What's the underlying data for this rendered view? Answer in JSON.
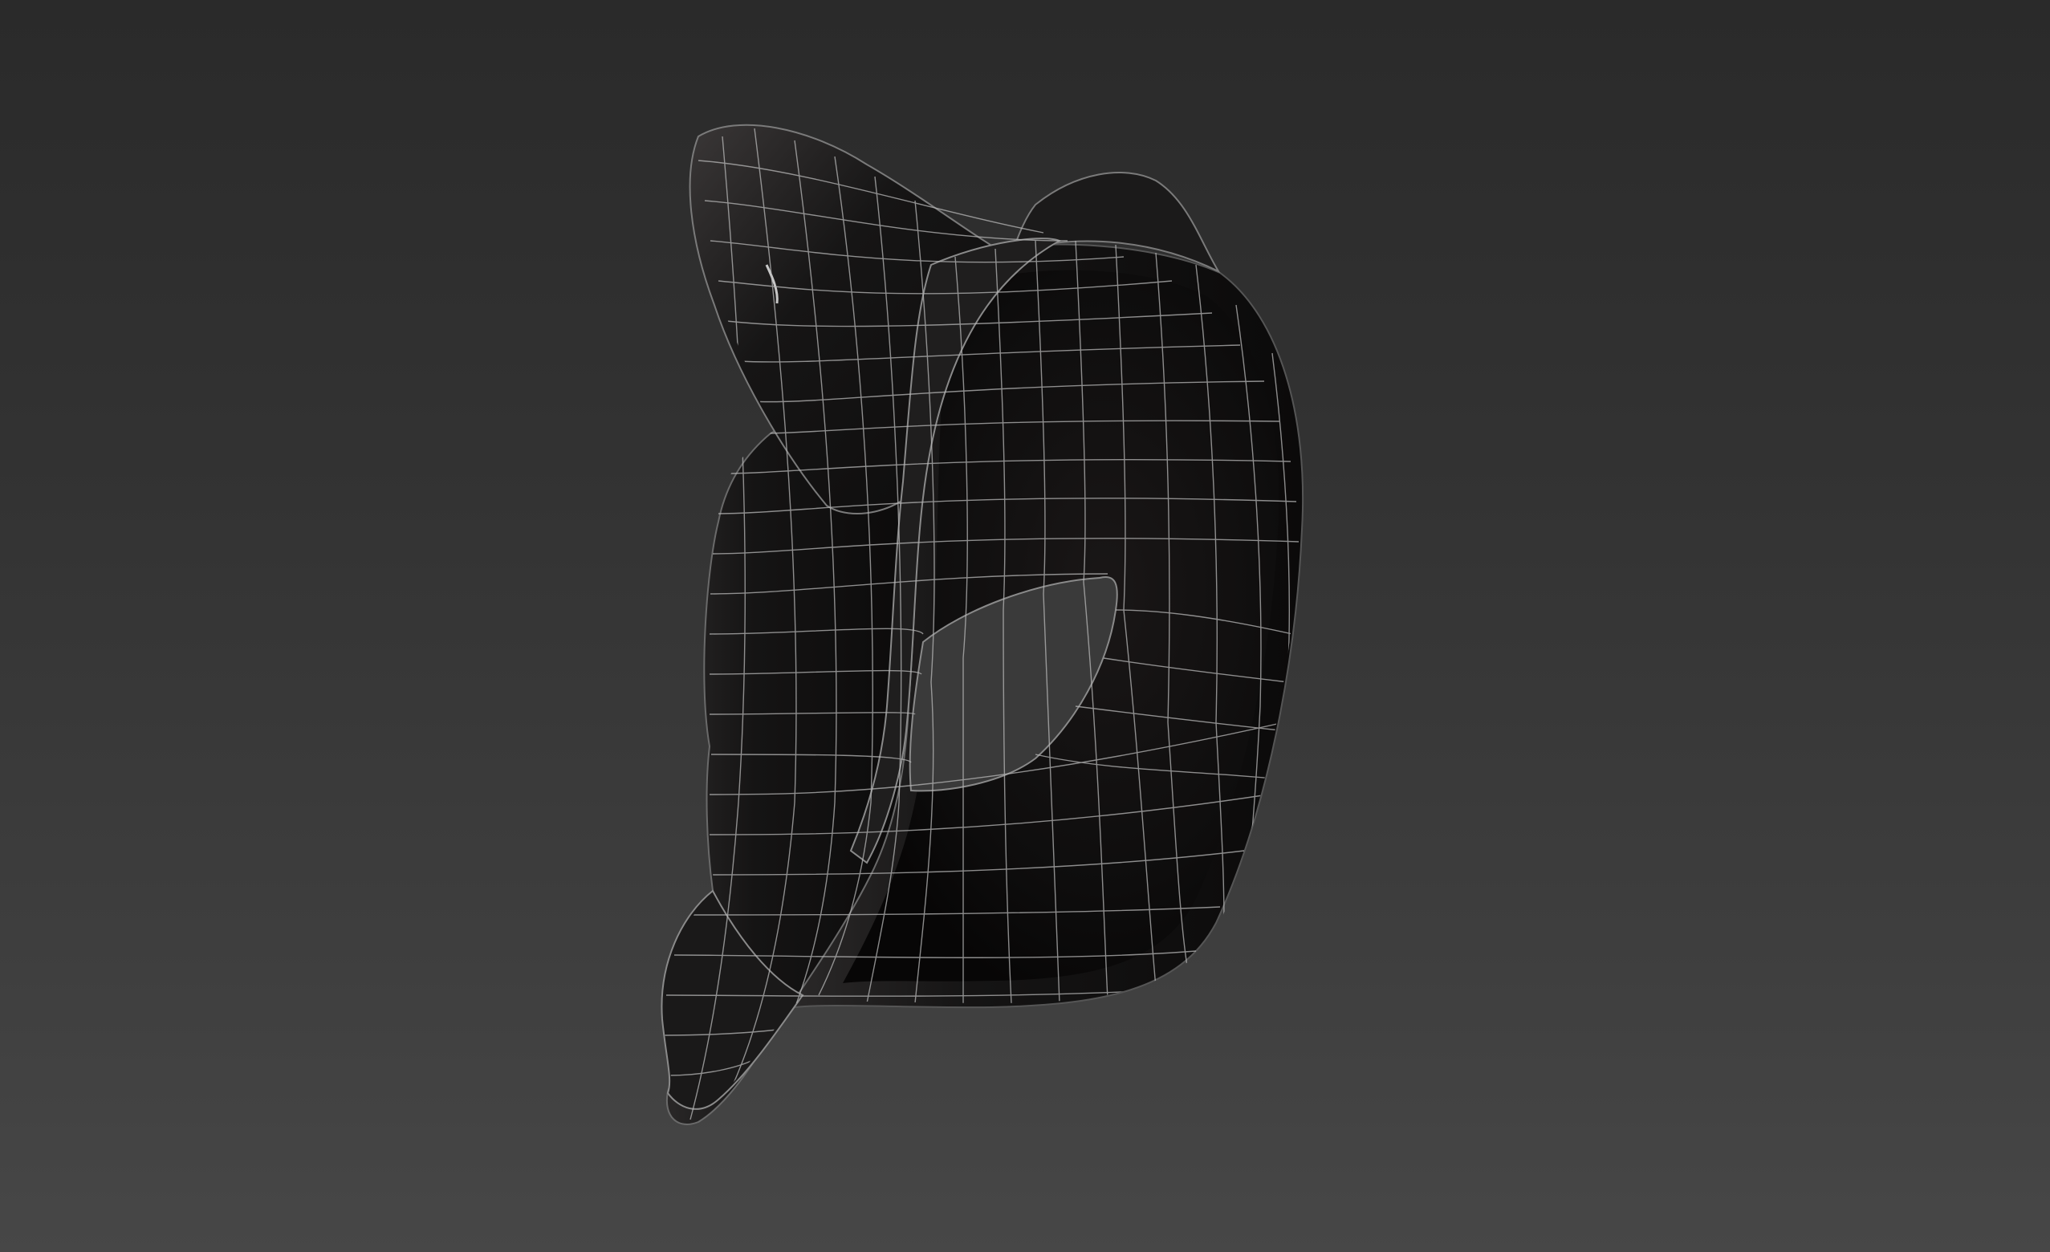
{
  "viewport": {
    "background_top": "#2a2a2a",
    "background_bottom": "#474747",
    "object": "fox-mask-model",
    "display_mode": "shaded-with-wireframe"
  },
  "model": {
    "shell_color": "#141313",
    "shell_highlight": "#3a3636",
    "inner_color": "#0c0b0b",
    "wire_color": "#bdbdbd"
  }
}
